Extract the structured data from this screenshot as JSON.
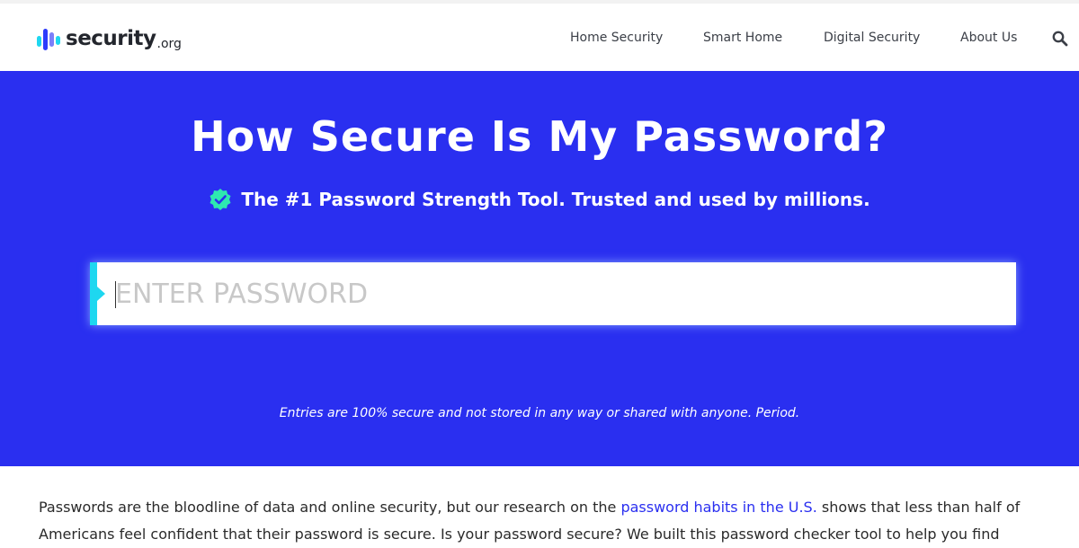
{
  "header": {
    "logo_word": "security",
    "logo_tld": ".org",
    "nav": [
      "Home Security",
      "Smart Home",
      "Digital Security",
      "About Us"
    ],
    "search_icon": "search-icon"
  },
  "hero": {
    "title": "How Secure Is My Password?",
    "subtitle": "The #1 Password Strength Tool. Trusted and used by millions.",
    "subtitle_icon": "check-badge-icon",
    "input_placeholder": "ENTER PASSWORD",
    "input_value": "",
    "note": "Entries are 100% secure and not stored in any way or shared with anyone. Period."
  },
  "body": {
    "text_before_link": "Passwords are the bloodline of data and online security, but our research on the ",
    "link_text": "password habits in the U.S.",
    "text_after_link": " shows that less than half of Americans feel confident that their password is secure. Is your password secure? We built this password checker tool to help you find"
  },
  "colors": {
    "hero_bg": "#2a2ff0",
    "accent_cyan": "#1ed7f0",
    "check_green": "#2ee8b0",
    "link": "#2a2ff0"
  }
}
